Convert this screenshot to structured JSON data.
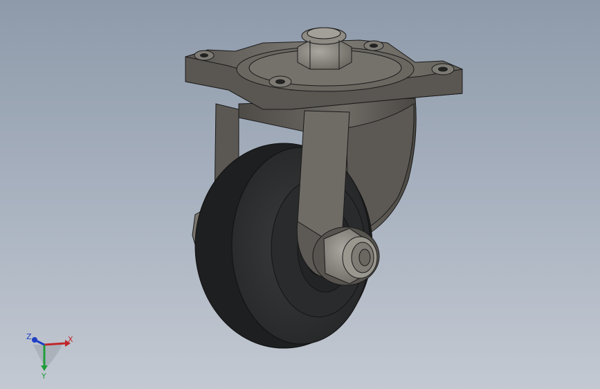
{
  "viewport": {
    "background_top": "#8e9aaa",
    "background_bottom": "#c3c9d2"
  },
  "model": {
    "name": "caster-wheel-assembly",
    "colors": {
      "metal_dark": "#4a4743",
      "metal_mid": "#6b6862",
      "metal_light": "#8d8a84",
      "rubber": "#2d2e2f",
      "rubber_edge": "#1c1d1e",
      "edge_line": "#1a1a1a"
    }
  },
  "triad": {
    "x_label": "X",
    "y_label": "Y",
    "z_label": "Z",
    "x_color": "#c0262b",
    "y_color": "#1f9d3a",
    "z_color": "#1f3fc4"
  }
}
